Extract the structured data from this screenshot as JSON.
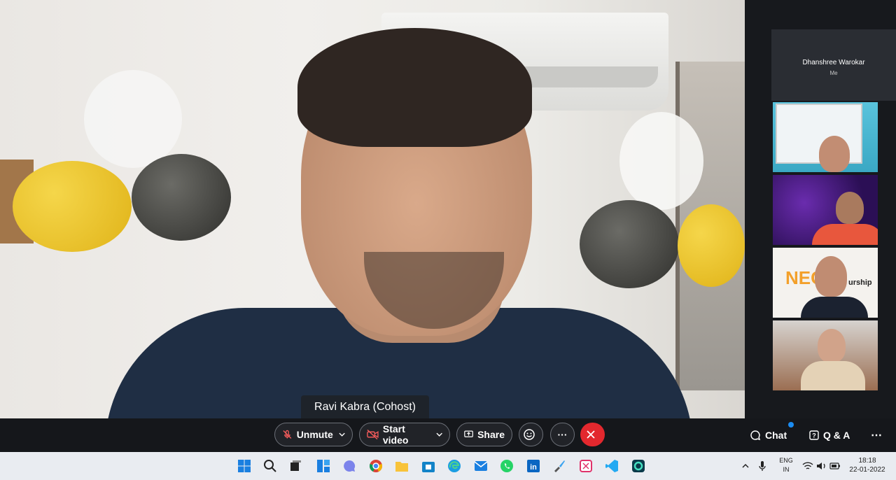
{
  "main_video": {
    "speaker_label": "Ravi Kabra (Cohost)"
  },
  "participants": {
    "self_name": "Dhanshree Warokar",
    "self_sub": "Me",
    "tile3_text": "urship"
  },
  "controls": {
    "unmute_label": "Unmute",
    "start_video_label": "Start video",
    "share_label": "Share",
    "chat_label": "Chat",
    "qa_label": "Q & A",
    "more_label": "···",
    "right_more_label": "⋯"
  },
  "colors": {
    "leave": "#e3282e",
    "chat_dot": "#1b8cf2"
  },
  "taskbar": {
    "icons": [
      "windows-start-icon",
      "search-icon",
      "task-view-icon",
      "widgets-icon",
      "teams-chat-icon",
      "chrome-icon",
      "file-explorer-icon",
      "store-icon",
      "edge-icon",
      "mail-icon",
      "whatsapp-icon",
      "linkedin-icon",
      "paint-icon",
      "snip-icon",
      "vscode-icon",
      "webex-icon"
    ],
    "lang_top": "ENG",
    "lang_bottom": "IN",
    "time": "18:18",
    "date": "22-01-2022"
  }
}
